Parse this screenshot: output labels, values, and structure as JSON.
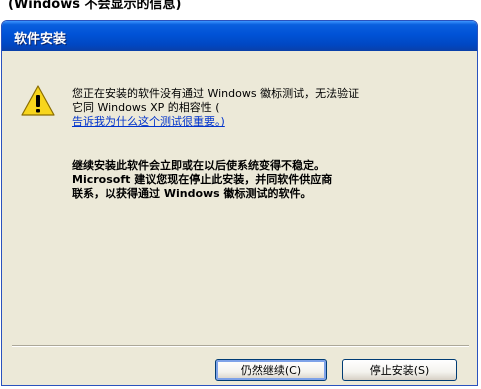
{
  "caption": "(Windows 不会显示的信息)",
  "window": {
    "title": "软件安装"
  },
  "message": {
    "line1": "您正在安装的软件没有通过 Windows 徽标测试，无法验证",
    "line2": "它同 Windows XP 的相容性 (",
    "link": "告诉我为什么这个测试很重要。)",
    "warning_line1": "继续安装此软件会立即或在以后使系统变得不稳定。",
    "warning_line2": "Microsoft 建议您现在停止此安装，并同软件供应商",
    "warning_line3": "联系，以获得通过 Windows 徽标测试的软件。"
  },
  "buttons": {
    "continue": "仍然继续(C)",
    "stop": "停止安装(S)"
  },
  "icon": "warning-icon"
}
